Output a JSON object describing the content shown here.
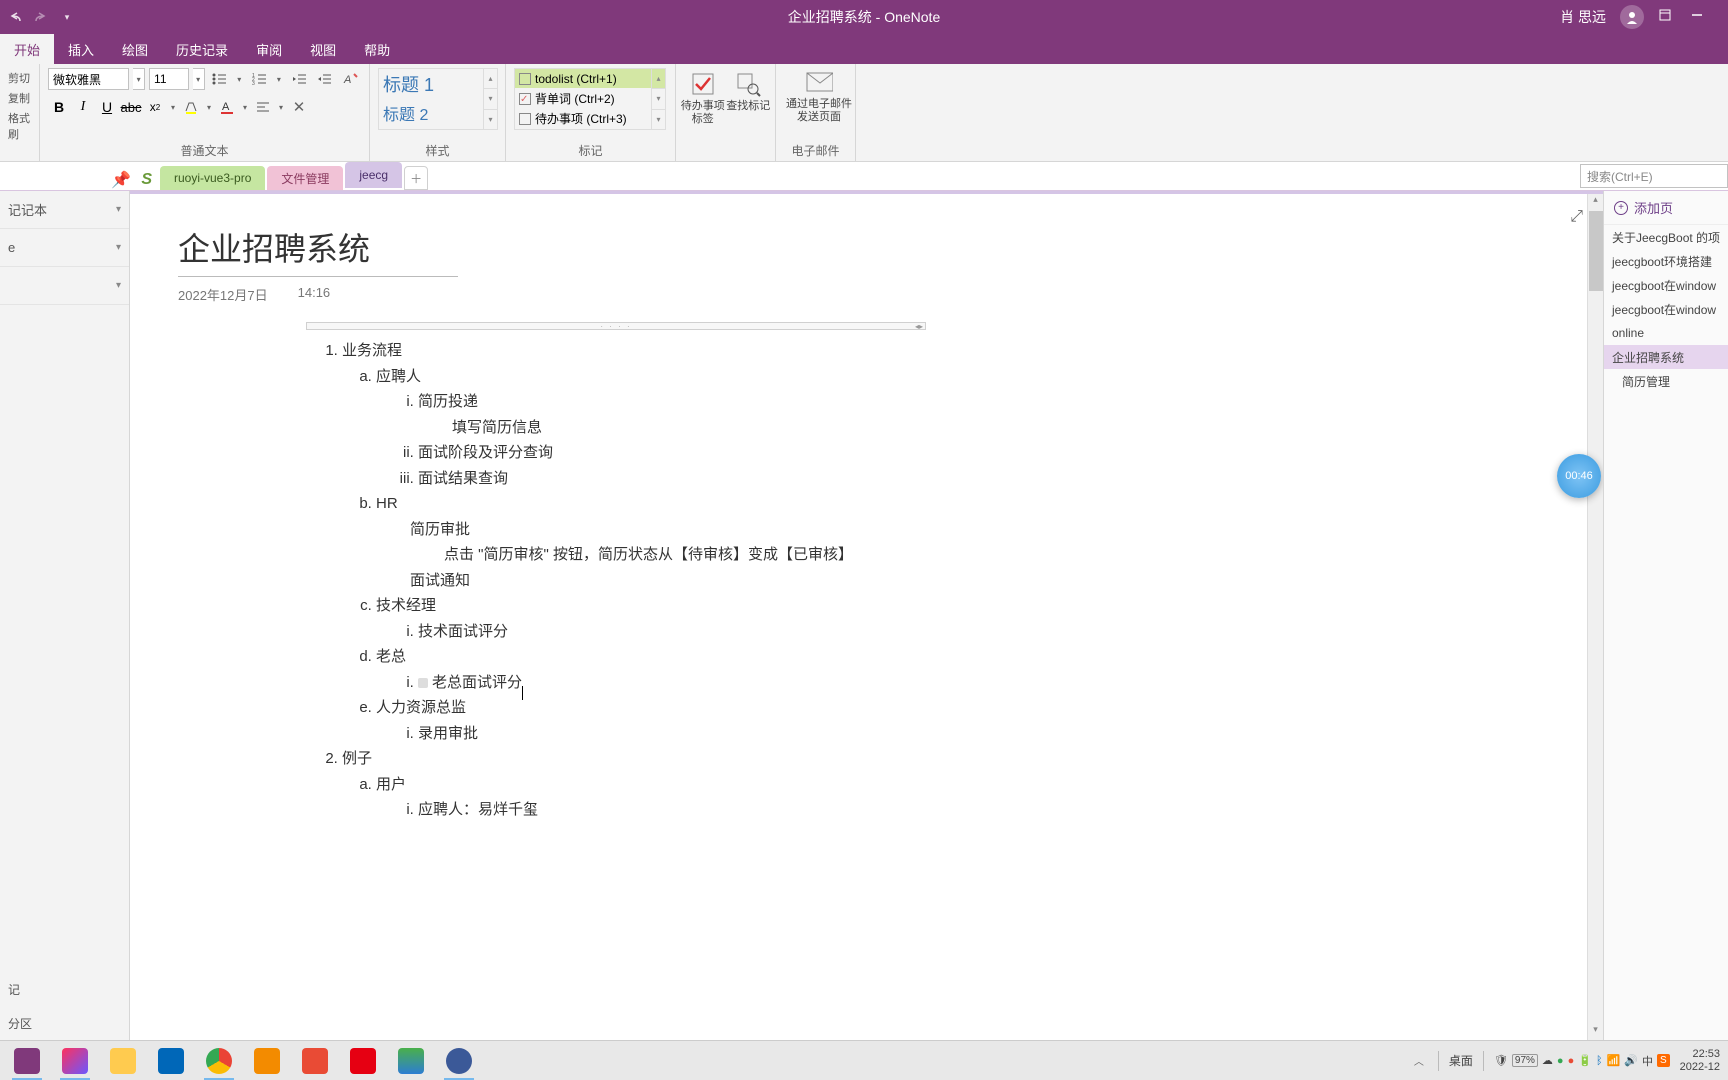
{
  "titlebar": {
    "title": "企业招聘系统  -  OneNote",
    "user": "肖 思远"
  },
  "ribbon_tabs": [
    "开始",
    "插入",
    "绘图",
    "历史记录",
    "审阅",
    "视图",
    "帮助"
  ],
  "clipboard": {
    "cut": "剪切",
    "copy": "复制",
    "painter": "格式刷"
  },
  "font": {
    "name": "微软雅黑",
    "size": "11",
    "group_label": "普通文本"
  },
  "styles": {
    "h1": "标题 1",
    "h2": "标题 2",
    "group_label": "样式"
  },
  "tags": {
    "items": [
      {
        "label": "todolist (Ctrl+1)",
        "sel": true
      },
      {
        "label": "背单词 (Ctrl+2)",
        "sel": false
      },
      {
        "label": "待办事项 (Ctrl+3)",
        "sel": false
      }
    ],
    "group_label": "标记",
    "todo_btn": "待办事项标签",
    "find_btn": "查找标记"
  },
  "email": {
    "btn": "通过电子邮件发送页面",
    "group_label": "电子邮件"
  },
  "sidebar": {
    "notebook": "记记本",
    "section": "e"
  },
  "section_tabs": {
    "t1": "ruoyi-vue3-pro",
    "t2": "文件管理",
    "t3": "jeecg"
  },
  "search_placeholder": "搜索(Ctrl+E)",
  "page": {
    "title": "企业招聘系统",
    "date": "2022年12月7日",
    "time": "14:16"
  },
  "outline": {
    "l1_1": "业务流程",
    "a": "应聘人",
    "a_i": "简历投递",
    "a_i_t": "填写简历信息",
    "a_ii": "面试阶段及评分查询",
    "a_iii": "面试结果查询",
    "b": "HR",
    "b_1": "简历审批",
    "b_1_t": "点击 \"简历审核\" 按钮，简历状态从【待审核】变成【已审核】",
    "b_2": "面试通知",
    "c": "技术经理",
    "c_i": "技术面试评分",
    "d": "老总",
    "d_i": "老总面试评分",
    "e": "人力资源总监",
    "e_i": "录用审批",
    "l1_2": "例子",
    "ex_a": "用户",
    "ex_a_i": "应聘人：易烊千玺"
  },
  "page_list": {
    "add": "添加页",
    "items": [
      {
        "label": "关于JeecgBoot 的项",
        "sub": false,
        "active": false
      },
      {
        "label": "jeecgboot环境搭建",
        "sub": false,
        "active": false
      },
      {
        "label": "jeecgboot在window",
        "sub": false,
        "active": false
      },
      {
        "label": "jeecgboot在window",
        "sub": false,
        "active": false
      },
      {
        "label": "online",
        "sub": false,
        "active": false
      },
      {
        "label": "企业招聘系统",
        "sub": false,
        "active": true
      },
      {
        "label": "简历管理",
        "sub": true,
        "active": false
      }
    ]
  },
  "timer": "00:46",
  "taskbar": {
    "desktop": "桌面",
    "battery": "97%",
    "time": "22:53",
    "date": "2022-12"
  }
}
